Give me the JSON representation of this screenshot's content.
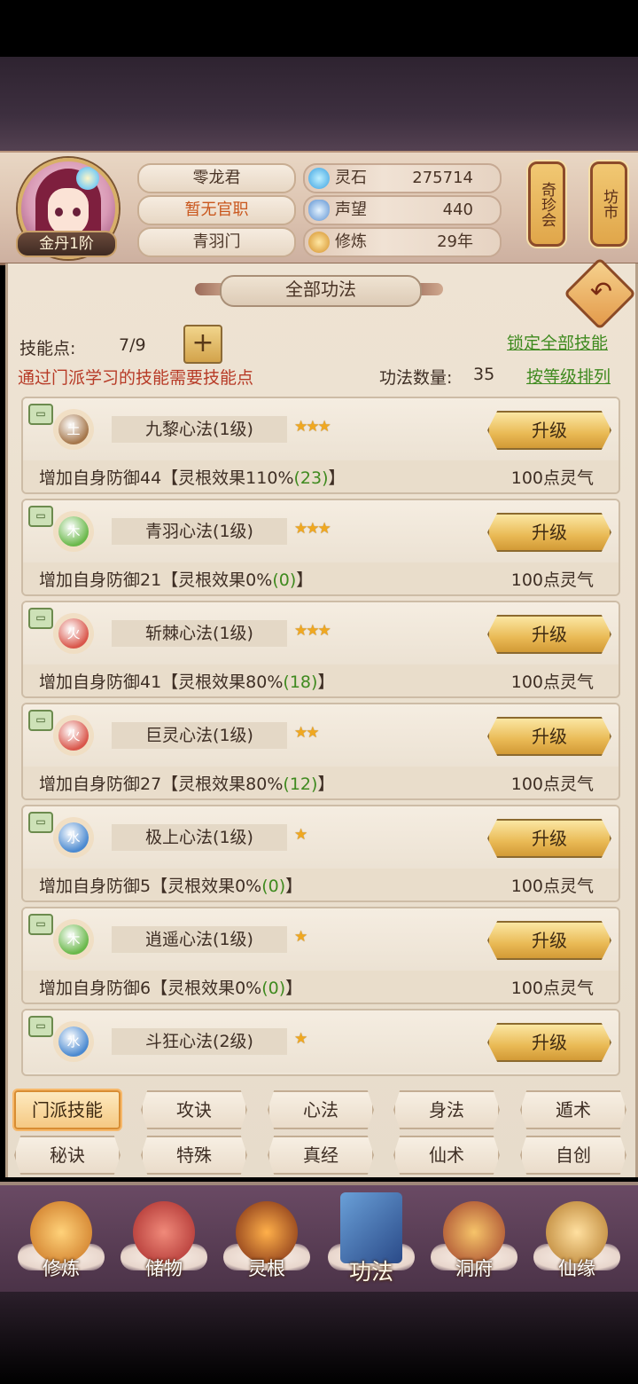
{
  "player": {
    "name": "零龙君",
    "title": "暂无官职",
    "sect": "青羽门",
    "rank": "金丹1阶"
  },
  "stats": [
    {
      "label": "灵石",
      "value": "275714",
      "icon": "spirit-stone-icon"
    },
    {
      "label": "声望",
      "value": "440",
      "icon": "reputation-icon"
    },
    {
      "label": "修炼",
      "value": "29年",
      "icon": "cultivation-icon"
    }
  ],
  "lanterns": {
    "treasure": "奇珍会",
    "market": "坊市"
  },
  "panel": {
    "title": "全部功法",
    "skill_points_label": "技能点:",
    "skill_points_value": "7/9",
    "lock_all": "锁定全部技能",
    "notice": "通过门派学习的技能需要技能点",
    "count_label": "功法数量:",
    "count_value": "35",
    "sort_by_level": "按等级排列"
  },
  "skills": [
    {
      "element": "土",
      "name": "九黎心法(1级)",
      "stars": "★★★",
      "upgrade": "升级",
      "desc_pre": "增加自身防御44【灵根效果110%",
      "desc_num": "(23)",
      "desc_post": "】",
      "cost": "100点灵气"
    },
    {
      "element": "木",
      "name": "青羽心法(1级)",
      "stars": "★★★",
      "upgrade": "升级",
      "desc_pre": "增加自身防御21【灵根效果0%",
      "desc_num": "(0)",
      "desc_post": "】",
      "cost": "100点灵气"
    },
    {
      "element": "火",
      "name": "斩棘心法(1级)",
      "stars": "★★★",
      "upgrade": "升级",
      "desc_pre": "增加自身防御41【灵根效果80%",
      "desc_num": "(18)",
      "desc_post": "】",
      "cost": "100点灵气"
    },
    {
      "element": "火",
      "name": "巨灵心法(1级)",
      "stars": "★★",
      "upgrade": "升级",
      "desc_pre": "增加自身防御27【灵根效果80%",
      "desc_num": "(12)",
      "desc_post": "】",
      "cost": "100点灵气"
    },
    {
      "element": "水",
      "name": "极上心法(1级)",
      "stars": "★",
      "upgrade": "升级",
      "desc_pre": "增加自身防御5【灵根效果0%",
      "desc_num": "(0)",
      "desc_post": "】",
      "cost": "100点灵气"
    },
    {
      "element": "木",
      "name": "逍遥心法(1级)",
      "stars": "★",
      "upgrade": "升级",
      "desc_pre": "增加自身防御6【灵根效果0%",
      "desc_num": "(0)",
      "desc_post": "】",
      "cost": "100点灵气"
    },
    {
      "element": "水",
      "name": "斗狂心法(2级)",
      "stars": "★",
      "upgrade": "升级"
    }
  ],
  "element_colors": {
    "土": "#a5764a",
    "木": "#69b84a",
    "火": "#d9564a",
    "水": "#4a89d0"
  },
  "tabs_row1": [
    "门派技能",
    "攻诀",
    "心法",
    "身法",
    "遁术"
  ],
  "tabs_row2": [
    "秘诀",
    "特殊",
    "真经",
    "仙术",
    "自创"
  ],
  "active_tab": "门派技能",
  "nav": [
    {
      "label": "修炼",
      "icon": "cultivate-icon"
    },
    {
      "label": "储物",
      "icon": "storage-bag-icon"
    },
    {
      "label": "灵根",
      "icon": "spirit-root-icon"
    },
    {
      "label": "功法",
      "icon": "skill-book-icon"
    },
    {
      "label": "洞府",
      "icon": "cave-house-icon"
    },
    {
      "label": "仙缘",
      "icon": "immortal-fate-icon"
    }
  ],
  "active_nav": "功法"
}
